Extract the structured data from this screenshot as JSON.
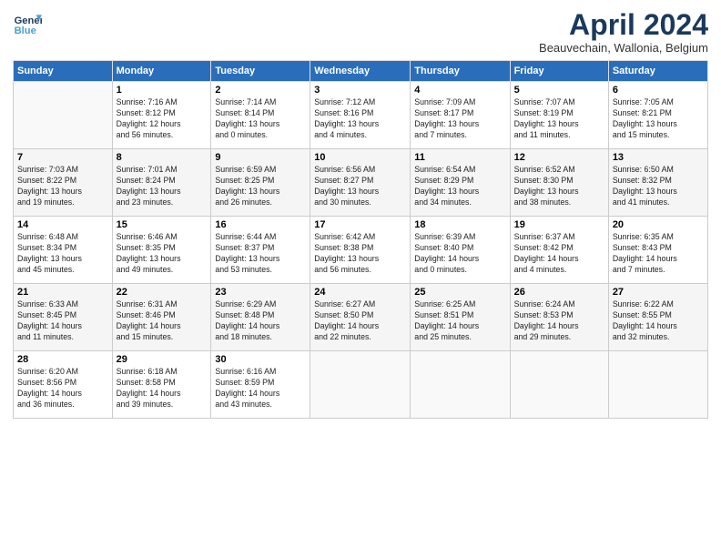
{
  "header": {
    "logo_line1": "General",
    "logo_line2": "Blue",
    "month": "April 2024",
    "location": "Beauvechain, Wallonia, Belgium"
  },
  "days_of_week": [
    "Sunday",
    "Monday",
    "Tuesday",
    "Wednesday",
    "Thursday",
    "Friday",
    "Saturday"
  ],
  "weeks": [
    [
      {
        "day": "",
        "info": ""
      },
      {
        "day": "1",
        "info": "Sunrise: 7:16 AM\nSunset: 8:12 PM\nDaylight: 12 hours\nand 56 minutes."
      },
      {
        "day": "2",
        "info": "Sunrise: 7:14 AM\nSunset: 8:14 PM\nDaylight: 13 hours\nand 0 minutes."
      },
      {
        "day": "3",
        "info": "Sunrise: 7:12 AM\nSunset: 8:16 PM\nDaylight: 13 hours\nand 4 minutes."
      },
      {
        "day": "4",
        "info": "Sunrise: 7:09 AM\nSunset: 8:17 PM\nDaylight: 13 hours\nand 7 minutes."
      },
      {
        "day": "5",
        "info": "Sunrise: 7:07 AM\nSunset: 8:19 PM\nDaylight: 13 hours\nand 11 minutes."
      },
      {
        "day": "6",
        "info": "Sunrise: 7:05 AM\nSunset: 8:21 PM\nDaylight: 13 hours\nand 15 minutes."
      }
    ],
    [
      {
        "day": "7",
        "info": "Sunrise: 7:03 AM\nSunset: 8:22 PM\nDaylight: 13 hours\nand 19 minutes."
      },
      {
        "day": "8",
        "info": "Sunrise: 7:01 AM\nSunset: 8:24 PM\nDaylight: 13 hours\nand 23 minutes."
      },
      {
        "day": "9",
        "info": "Sunrise: 6:59 AM\nSunset: 8:25 PM\nDaylight: 13 hours\nand 26 minutes."
      },
      {
        "day": "10",
        "info": "Sunrise: 6:56 AM\nSunset: 8:27 PM\nDaylight: 13 hours\nand 30 minutes."
      },
      {
        "day": "11",
        "info": "Sunrise: 6:54 AM\nSunset: 8:29 PM\nDaylight: 13 hours\nand 34 minutes."
      },
      {
        "day": "12",
        "info": "Sunrise: 6:52 AM\nSunset: 8:30 PM\nDaylight: 13 hours\nand 38 minutes."
      },
      {
        "day": "13",
        "info": "Sunrise: 6:50 AM\nSunset: 8:32 PM\nDaylight: 13 hours\nand 41 minutes."
      }
    ],
    [
      {
        "day": "14",
        "info": "Sunrise: 6:48 AM\nSunset: 8:34 PM\nDaylight: 13 hours\nand 45 minutes."
      },
      {
        "day": "15",
        "info": "Sunrise: 6:46 AM\nSunset: 8:35 PM\nDaylight: 13 hours\nand 49 minutes."
      },
      {
        "day": "16",
        "info": "Sunrise: 6:44 AM\nSunset: 8:37 PM\nDaylight: 13 hours\nand 53 minutes."
      },
      {
        "day": "17",
        "info": "Sunrise: 6:42 AM\nSunset: 8:38 PM\nDaylight: 13 hours\nand 56 minutes."
      },
      {
        "day": "18",
        "info": "Sunrise: 6:39 AM\nSunset: 8:40 PM\nDaylight: 14 hours\nand 0 minutes."
      },
      {
        "day": "19",
        "info": "Sunrise: 6:37 AM\nSunset: 8:42 PM\nDaylight: 14 hours\nand 4 minutes."
      },
      {
        "day": "20",
        "info": "Sunrise: 6:35 AM\nSunset: 8:43 PM\nDaylight: 14 hours\nand 7 minutes."
      }
    ],
    [
      {
        "day": "21",
        "info": "Sunrise: 6:33 AM\nSunset: 8:45 PM\nDaylight: 14 hours\nand 11 minutes."
      },
      {
        "day": "22",
        "info": "Sunrise: 6:31 AM\nSunset: 8:46 PM\nDaylight: 14 hours\nand 15 minutes."
      },
      {
        "day": "23",
        "info": "Sunrise: 6:29 AM\nSunset: 8:48 PM\nDaylight: 14 hours\nand 18 minutes."
      },
      {
        "day": "24",
        "info": "Sunrise: 6:27 AM\nSunset: 8:50 PM\nDaylight: 14 hours\nand 22 minutes."
      },
      {
        "day": "25",
        "info": "Sunrise: 6:25 AM\nSunset: 8:51 PM\nDaylight: 14 hours\nand 25 minutes."
      },
      {
        "day": "26",
        "info": "Sunrise: 6:24 AM\nSunset: 8:53 PM\nDaylight: 14 hours\nand 29 minutes."
      },
      {
        "day": "27",
        "info": "Sunrise: 6:22 AM\nSunset: 8:55 PM\nDaylight: 14 hours\nand 32 minutes."
      }
    ],
    [
      {
        "day": "28",
        "info": "Sunrise: 6:20 AM\nSunset: 8:56 PM\nDaylight: 14 hours\nand 36 minutes."
      },
      {
        "day": "29",
        "info": "Sunrise: 6:18 AM\nSunset: 8:58 PM\nDaylight: 14 hours\nand 39 minutes."
      },
      {
        "day": "30",
        "info": "Sunrise: 6:16 AM\nSunset: 8:59 PM\nDaylight: 14 hours\nand 43 minutes."
      },
      {
        "day": "",
        "info": ""
      },
      {
        "day": "",
        "info": ""
      },
      {
        "day": "",
        "info": ""
      },
      {
        "day": "",
        "info": ""
      }
    ]
  ]
}
